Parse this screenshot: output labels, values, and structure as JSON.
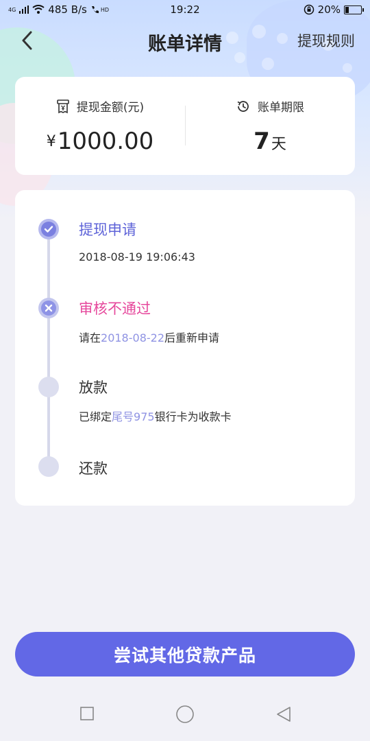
{
  "status_bar": {
    "network_text": "4G",
    "speed": "485 B/s",
    "hd_text": "HD",
    "time": "19:22",
    "battery": "20%",
    "battery_level": 0.2
  },
  "nav": {
    "title": "账单详情",
    "rules_label": "提现规则"
  },
  "summary": {
    "amount_label": "提现金额(元)",
    "amount_prefix": "¥",
    "amount_value": "1000.00",
    "period_label": "账单期限",
    "period_value": "7",
    "period_unit": "天"
  },
  "timeline": {
    "steps": [
      {
        "title": "提现申请",
        "state": "done",
        "sub": "2018-08-19 19:06:43"
      },
      {
        "title": "审核不通过",
        "state": "failed",
        "sub_prefix": "请在",
        "sub_highlight": "2018-08-22",
        "sub_suffix": "后重新申请"
      },
      {
        "title": "放款",
        "state": "pending",
        "sub_prefix": "已绑定",
        "sub_highlight": "尾号975",
        "sub_suffix": "银行卡为收款卡"
      },
      {
        "title": "还款",
        "state": "pending"
      }
    ]
  },
  "action": {
    "label": "尝试其他贷款产品"
  },
  "colors": {
    "accent": "#6268e6",
    "done": "#5e63d8",
    "fail": "#e6489c",
    "highlight": "#8f93e3"
  }
}
